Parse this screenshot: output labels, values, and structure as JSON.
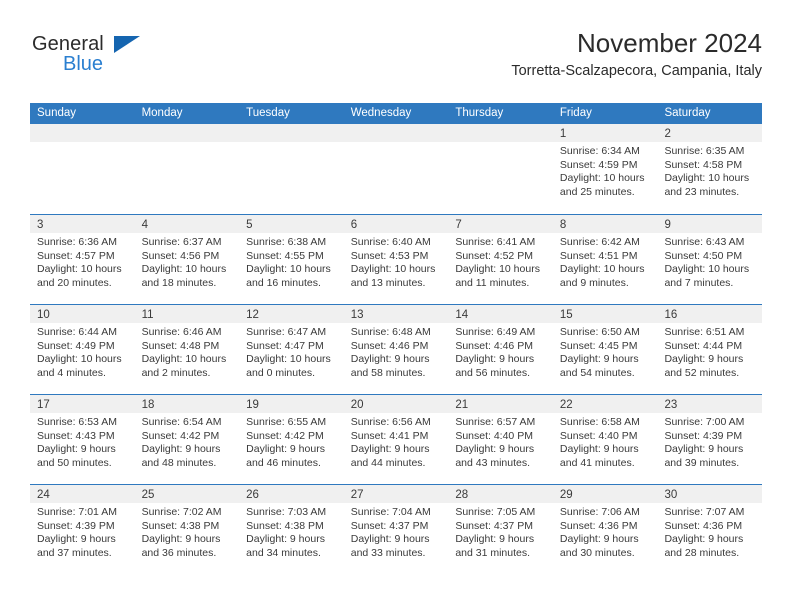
{
  "brand": {
    "name_top": "General",
    "name_bottom": "Blue",
    "accent_color": "#2a7fd0",
    "triangle_color": "#1565b0"
  },
  "header": {
    "title": "November 2024",
    "subtitle": "Torretta-Scalzapecora, Campania, Italy"
  },
  "calendar": {
    "header_bg": "#2f79bf",
    "daynum_bg": "#f0f0f0",
    "weekdays": [
      "Sunday",
      "Monday",
      "Tuesday",
      "Wednesday",
      "Thursday",
      "Friday",
      "Saturday"
    ],
    "weeks": [
      [
        {
          "date": "",
          "empty": true
        },
        {
          "date": "",
          "empty": true
        },
        {
          "date": "",
          "empty": true
        },
        {
          "date": "",
          "empty": true
        },
        {
          "date": "",
          "empty": true
        },
        {
          "date": "1",
          "sunrise": "Sunrise: 6:34 AM",
          "sunset": "Sunset: 4:59 PM",
          "daylight": "Daylight: 10 hours and 25 minutes."
        },
        {
          "date": "2",
          "sunrise": "Sunrise: 6:35 AM",
          "sunset": "Sunset: 4:58 PM",
          "daylight": "Daylight: 10 hours and 23 minutes."
        }
      ],
      [
        {
          "date": "3",
          "sunrise": "Sunrise: 6:36 AM",
          "sunset": "Sunset: 4:57 PM",
          "daylight": "Daylight: 10 hours and 20 minutes."
        },
        {
          "date": "4",
          "sunrise": "Sunrise: 6:37 AM",
          "sunset": "Sunset: 4:56 PM",
          "daylight": "Daylight: 10 hours and 18 minutes."
        },
        {
          "date": "5",
          "sunrise": "Sunrise: 6:38 AM",
          "sunset": "Sunset: 4:55 PM",
          "daylight": "Daylight: 10 hours and 16 minutes."
        },
        {
          "date": "6",
          "sunrise": "Sunrise: 6:40 AM",
          "sunset": "Sunset: 4:53 PM",
          "daylight": "Daylight: 10 hours and 13 minutes."
        },
        {
          "date": "7",
          "sunrise": "Sunrise: 6:41 AM",
          "sunset": "Sunset: 4:52 PM",
          "daylight": "Daylight: 10 hours and 11 minutes."
        },
        {
          "date": "8",
          "sunrise": "Sunrise: 6:42 AM",
          "sunset": "Sunset: 4:51 PM",
          "daylight": "Daylight: 10 hours and 9 minutes."
        },
        {
          "date": "9",
          "sunrise": "Sunrise: 6:43 AM",
          "sunset": "Sunset: 4:50 PM",
          "daylight": "Daylight: 10 hours and 7 minutes."
        }
      ],
      [
        {
          "date": "10",
          "sunrise": "Sunrise: 6:44 AM",
          "sunset": "Sunset: 4:49 PM",
          "daylight": "Daylight: 10 hours and 4 minutes."
        },
        {
          "date": "11",
          "sunrise": "Sunrise: 6:46 AM",
          "sunset": "Sunset: 4:48 PM",
          "daylight": "Daylight: 10 hours and 2 minutes."
        },
        {
          "date": "12",
          "sunrise": "Sunrise: 6:47 AM",
          "sunset": "Sunset: 4:47 PM",
          "daylight": "Daylight: 10 hours and 0 minutes."
        },
        {
          "date": "13",
          "sunrise": "Sunrise: 6:48 AM",
          "sunset": "Sunset: 4:46 PM",
          "daylight": "Daylight: 9 hours and 58 minutes."
        },
        {
          "date": "14",
          "sunrise": "Sunrise: 6:49 AM",
          "sunset": "Sunset: 4:46 PM",
          "daylight": "Daylight: 9 hours and 56 minutes."
        },
        {
          "date": "15",
          "sunrise": "Sunrise: 6:50 AM",
          "sunset": "Sunset: 4:45 PM",
          "daylight": "Daylight: 9 hours and 54 minutes."
        },
        {
          "date": "16",
          "sunrise": "Sunrise: 6:51 AM",
          "sunset": "Sunset: 4:44 PM",
          "daylight": "Daylight: 9 hours and 52 minutes."
        }
      ],
      [
        {
          "date": "17",
          "sunrise": "Sunrise: 6:53 AM",
          "sunset": "Sunset: 4:43 PM",
          "daylight": "Daylight: 9 hours and 50 minutes."
        },
        {
          "date": "18",
          "sunrise": "Sunrise: 6:54 AM",
          "sunset": "Sunset: 4:42 PM",
          "daylight": "Daylight: 9 hours and 48 minutes."
        },
        {
          "date": "19",
          "sunrise": "Sunrise: 6:55 AM",
          "sunset": "Sunset: 4:42 PM",
          "daylight": "Daylight: 9 hours and 46 minutes."
        },
        {
          "date": "20",
          "sunrise": "Sunrise: 6:56 AM",
          "sunset": "Sunset: 4:41 PM",
          "daylight": "Daylight: 9 hours and 44 minutes."
        },
        {
          "date": "21",
          "sunrise": "Sunrise: 6:57 AM",
          "sunset": "Sunset: 4:40 PM",
          "daylight": "Daylight: 9 hours and 43 minutes."
        },
        {
          "date": "22",
          "sunrise": "Sunrise: 6:58 AM",
          "sunset": "Sunset: 4:40 PM",
          "daylight": "Daylight: 9 hours and 41 minutes."
        },
        {
          "date": "23",
          "sunrise": "Sunrise: 7:00 AM",
          "sunset": "Sunset: 4:39 PM",
          "daylight": "Daylight: 9 hours and 39 minutes."
        }
      ],
      [
        {
          "date": "24",
          "sunrise": "Sunrise: 7:01 AM",
          "sunset": "Sunset: 4:39 PM",
          "daylight": "Daylight: 9 hours and 37 minutes."
        },
        {
          "date": "25",
          "sunrise": "Sunrise: 7:02 AM",
          "sunset": "Sunset: 4:38 PM",
          "daylight": "Daylight: 9 hours and 36 minutes."
        },
        {
          "date": "26",
          "sunrise": "Sunrise: 7:03 AM",
          "sunset": "Sunset: 4:38 PM",
          "daylight": "Daylight: 9 hours and 34 minutes."
        },
        {
          "date": "27",
          "sunrise": "Sunrise: 7:04 AM",
          "sunset": "Sunset: 4:37 PM",
          "daylight": "Daylight: 9 hours and 33 minutes."
        },
        {
          "date": "28",
          "sunrise": "Sunrise: 7:05 AM",
          "sunset": "Sunset: 4:37 PM",
          "daylight": "Daylight: 9 hours and 31 minutes."
        },
        {
          "date": "29",
          "sunrise": "Sunrise: 7:06 AM",
          "sunset": "Sunset: 4:36 PM",
          "daylight": "Daylight: 9 hours and 30 minutes."
        },
        {
          "date": "30",
          "sunrise": "Sunrise: 7:07 AM",
          "sunset": "Sunset: 4:36 PM",
          "daylight": "Daylight: 9 hours and 28 minutes."
        }
      ]
    ]
  }
}
